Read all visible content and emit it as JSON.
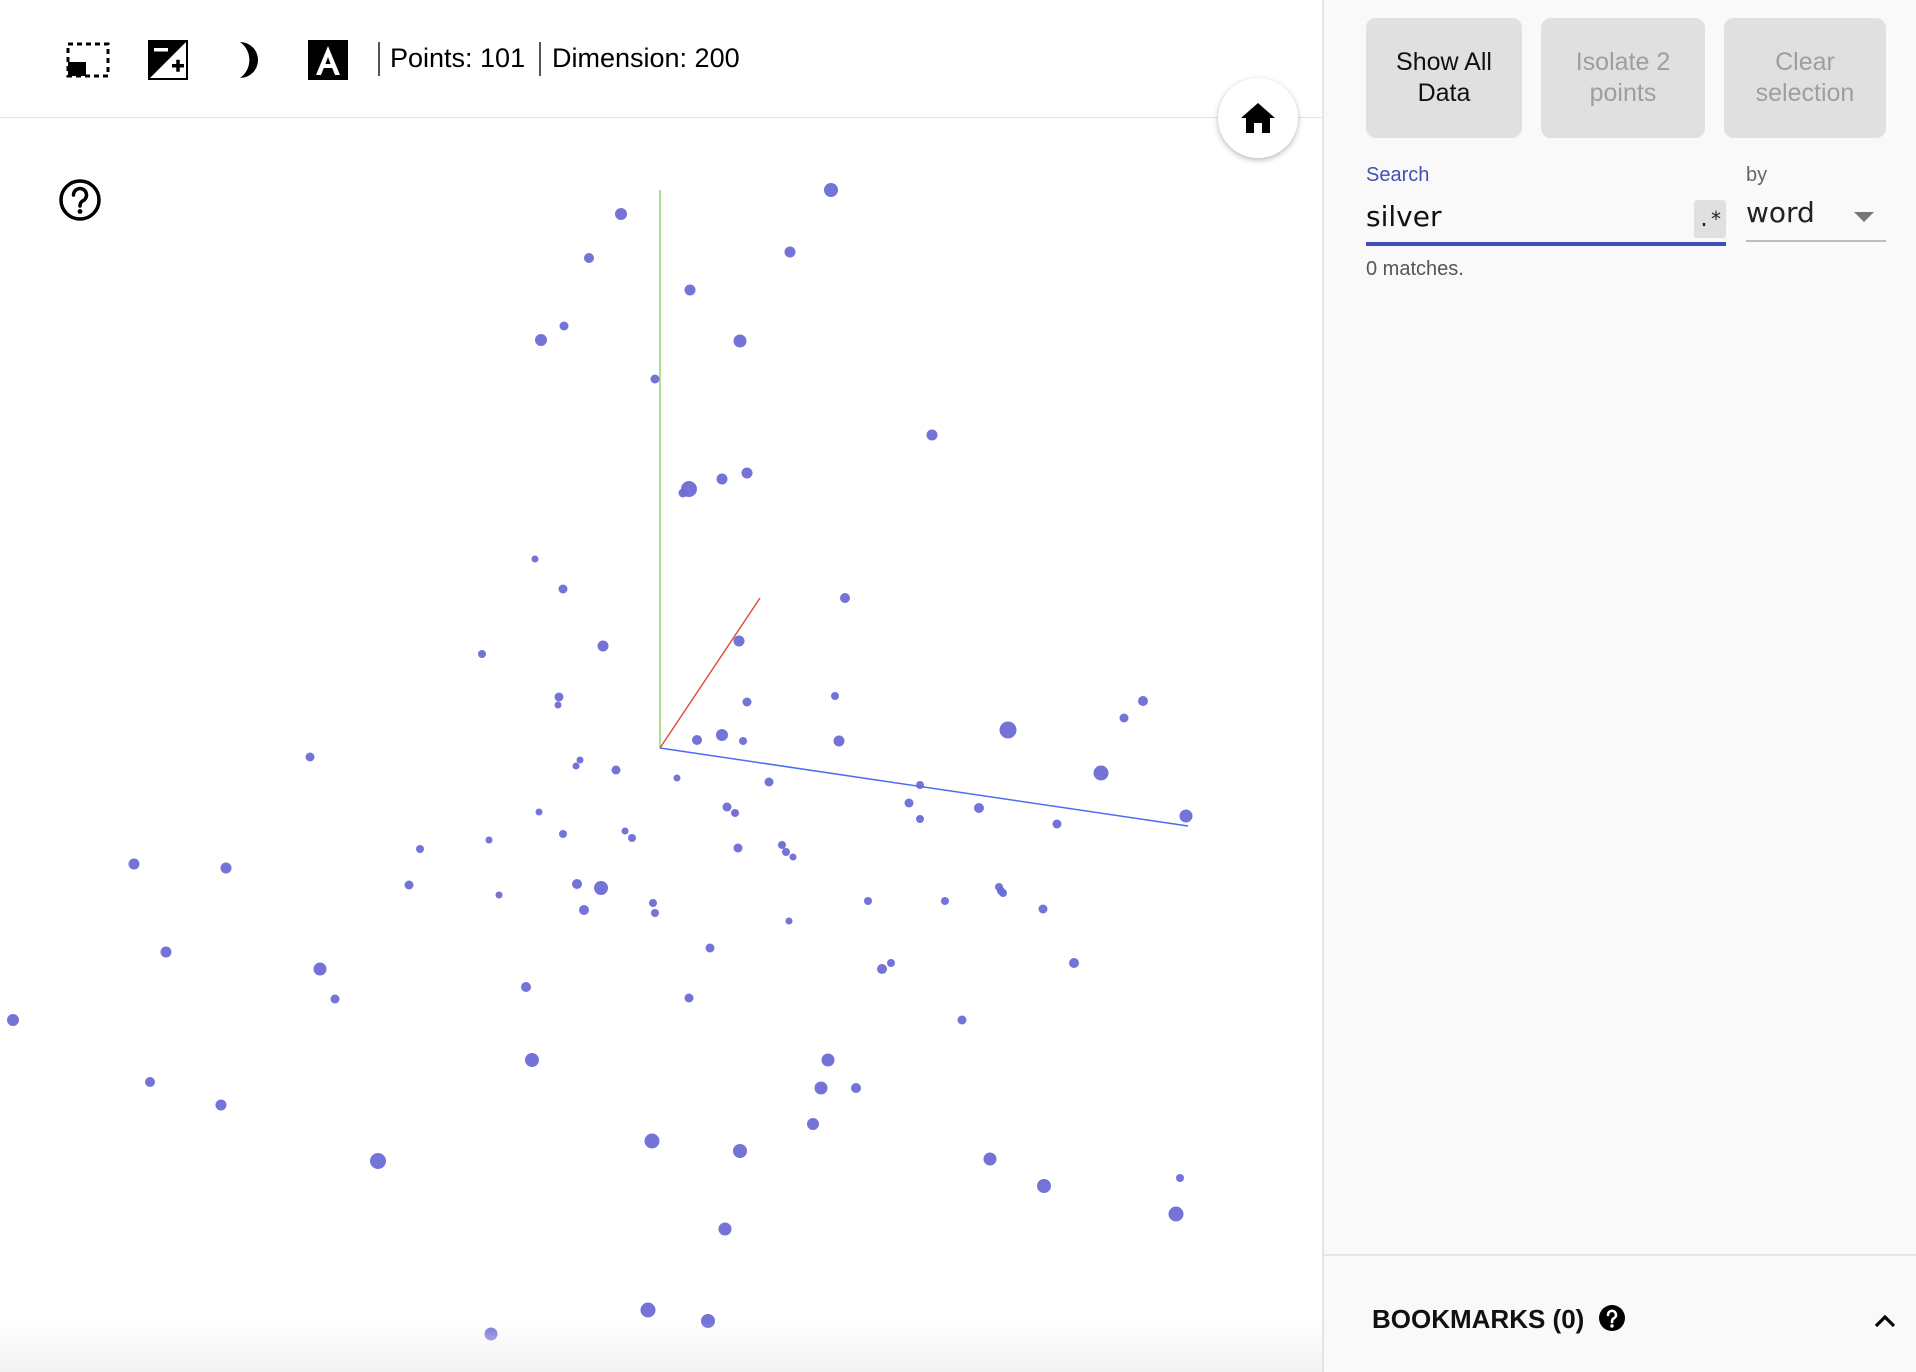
{
  "toolbar": {
    "icons": [
      "select-rectangle-icon",
      "night-mode-toggle-icon",
      "moon-icon",
      "label-toggle-icon"
    ],
    "points_label": "Points: 101",
    "dimension_label": "Dimension: 200"
  },
  "projection": {
    "axes": {
      "x_color": "#4a6cf2",
      "y_color": "#93d36b",
      "z_color": "#e2533e"
    },
    "point_color": "#6b6bd6",
    "point_count": 101
  },
  "panel": {
    "buttons": [
      {
        "label_line1": "Show All",
        "label_line2": "Data",
        "enabled": true
      },
      {
        "label_line1": "Isolate 2",
        "label_line2": "points",
        "enabled": false
      },
      {
        "label_line1": "Clear",
        "label_line2": "selection",
        "enabled": false
      }
    ],
    "search": {
      "label": "Search",
      "value": "silver",
      "regex_label": ".*",
      "matches_text": "0 matches."
    },
    "by": {
      "label": "by",
      "value": "word"
    },
    "bookmarks": {
      "title": "BOOKMARKS (0)"
    }
  }
}
